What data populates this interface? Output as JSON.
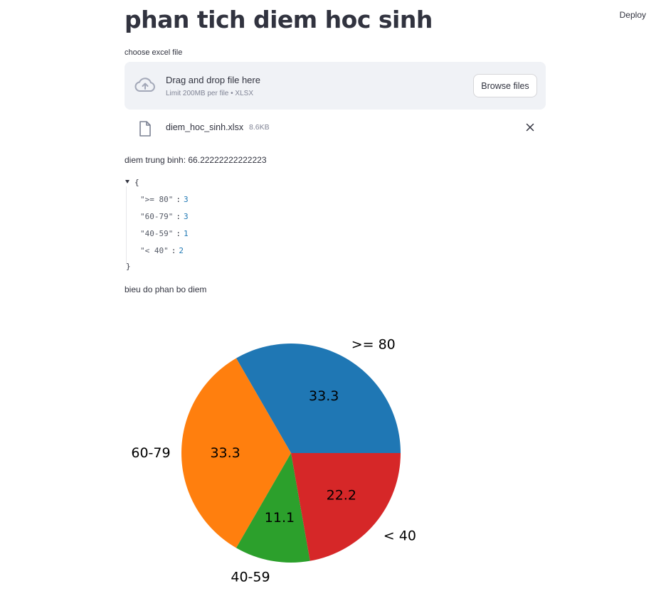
{
  "header": {
    "deploy_label": "Deploy"
  },
  "page": {
    "title": "phan tich diem hoc sinh"
  },
  "uploader": {
    "label": "choose excel file",
    "drop_text": "Drag and drop file here",
    "limit_text": "Limit 200MB per file • XLSX",
    "browse_label": "Browse files",
    "file": {
      "name": "diem_hoc_sinh.xlsx",
      "size": "8.6KB"
    }
  },
  "average_text": "diem trung binh: 66.22222222222223",
  "json_view": {
    "open_brace": "{",
    "close_brace": "}",
    "colon": ":",
    "entries": [
      {
        "key": "\">= 80\"",
        "value": "3"
      },
      {
        "key": "\"60-79\"",
        "value": "3"
      },
      {
        "key": "\"40-59\"",
        "value": "1"
      },
      {
        "key": "\"< 40\"",
        "value": "2"
      }
    ]
  },
  "chart_caption": "bieu do phan bo diem",
  "chart_data": {
    "type": "pie",
    "categories": [
      ">= 80",
      "60-79",
      "40-59",
      "< 40"
    ],
    "values": [
      3,
      3,
      1,
      2
    ],
    "percent_labels": [
      "33.3",
      "33.3",
      "11.1",
      "22.2"
    ],
    "colors": [
      "#1f77b4",
      "#ff7f0e",
      "#2ca02c",
      "#d62728"
    ],
    "start_angle_deg": 0,
    "title": ""
  }
}
